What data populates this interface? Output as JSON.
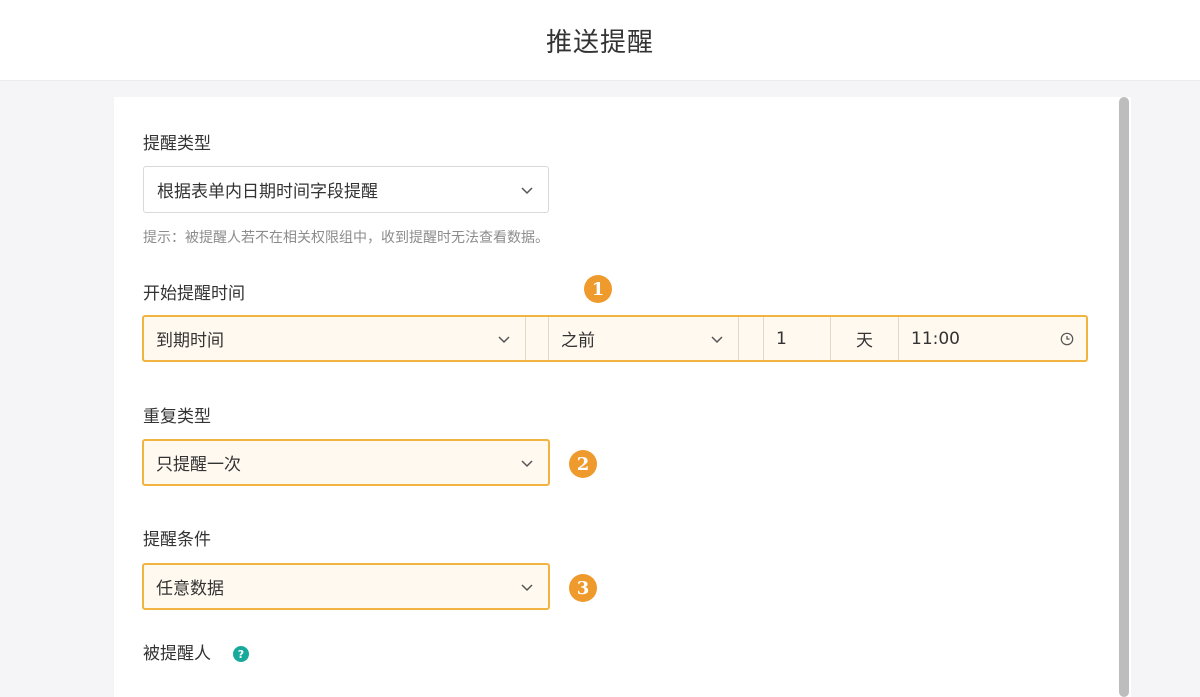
{
  "header": {
    "title": "推送提醒"
  },
  "form": {
    "reminder_type": {
      "label": "提醒类型",
      "value": "根据表单内日期时间字段提醒",
      "hint": "提示：被提醒人若不在相关权限组中，收到提醒时无法查看数据。"
    },
    "start_time": {
      "label": "开始提醒时间",
      "field_value": "到期时间",
      "relation_value": "之前",
      "offset_value": "1",
      "unit_label": "天",
      "time_value": "11:00"
    },
    "repeat_type": {
      "label": "重复类型",
      "value": "只提醒一次"
    },
    "condition": {
      "label": "提醒条件",
      "value": "任意数据"
    },
    "recipients": {
      "label": "被提醒人",
      "help_symbol": "?"
    }
  },
  "annotations": {
    "badge_1": "1",
    "badge_2": "2",
    "badge_3": "3"
  },
  "colors": {
    "highlight_border": "#f2b441",
    "highlight_fill": "#fff9f0",
    "badge": "#ef9a2d",
    "help_icon": "#17a99a"
  },
  "icons": {
    "dropdown": "chevron-down-icon",
    "time": "clock-icon",
    "help": "help-icon"
  }
}
